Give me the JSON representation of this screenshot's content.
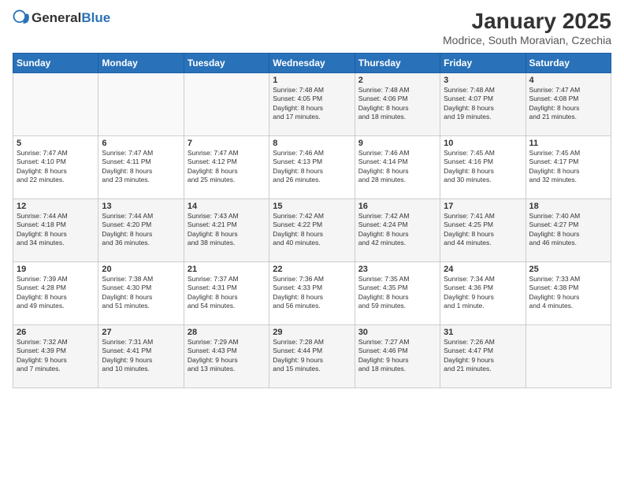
{
  "header": {
    "logo_general": "General",
    "logo_blue": "Blue",
    "title": "January 2025",
    "subtitle": "Modrice, South Moravian, Czechia"
  },
  "weekdays": [
    "Sunday",
    "Monday",
    "Tuesday",
    "Wednesday",
    "Thursday",
    "Friday",
    "Saturday"
  ],
  "weeks": [
    [
      {
        "day": "",
        "info": ""
      },
      {
        "day": "",
        "info": ""
      },
      {
        "day": "",
        "info": ""
      },
      {
        "day": "1",
        "info": "Sunrise: 7:48 AM\nSunset: 4:05 PM\nDaylight: 8 hours\nand 17 minutes."
      },
      {
        "day": "2",
        "info": "Sunrise: 7:48 AM\nSunset: 4:06 PM\nDaylight: 8 hours\nand 18 minutes."
      },
      {
        "day": "3",
        "info": "Sunrise: 7:48 AM\nSunset: 4:07 PM\nDaylight: 8 hours\nand 19 minutes."
      },
      {
        "day": "4",
        "info": "Sunrise: 7:47 AM\nSunset: 4:08 PM\nDaylight: 8 hours\nand 21 minutes."
      }
    ],
    [
      {
        "day": "5",
        "info": "Sunrise: 7:47 AM\nSunset: 4:10 PM\nDaylight: 8 hours\nand 22 minutes."
      },
      {
        "day": "6",
        "info": "Sunrise: 7:47 AM\nSunset: 4:11 PM\nDaylight: 8 hours\nand 23 minutes."
      },
      {
        "day": "7",
        "info": "Sunrise: 7:47 AM\nSunset: 4:12 PM\nDaylight: 8 hours\nand 25 minutes."
      },
      {
        "day": "8",
        "info": "Sunrise: 7:46 AM\nSunset: 4:13 PM\nDaylight: 8 hours\nand 26 minutes."
      },
      {
        "day": "9",
        "info": "Sunrise: 7:46 AM\nSunset: 4:14 PM\nDaylight: 8 hours\nand 28 minutes."
      },
      {
        "day": "10",
        "info": "Sunrise: 7:45 AM\nSunset: 4:16 PM\nDaylight: 8 hours\nand 30 minutes."
      },
      {
        "day": "11",
        "info": "Sunrise: 7:45 AM\nSunset: 4:17 PM\nDaylight: 8 hours\nand 32 minutes."
      }
    ],
    [
      {
        "day": "12",
        "info": "Sunrise: 7:44 AM\nSunset: 4:18 PM\nDaylight: 8 hours\nand 34 minutes."
      },
      {
        "day": "13",
        "info": "Sunrise: 7:44 AM\nSunset: 4:20 PM\nDaylight: 8 hours\nand 36 minutes."
      },
      {
        "day": "14",
        "info": "Sunrise: 7:43 AM\nSunset: 4:21 PM\nDaylight: 8 hours\nand 38 minutes."
      },
      {
        "day": "15",
        "info": "Sunrise: 7:42 AM\nSunset: 4:22 PM\nDaylight: 8 hours\nand 40 minutes."
      },
      {
        "day": "16",
        "info": "Sunrise: 7:42 AM\nSunset: 4:24 PM\nDaylight: 8 hours\nand 42 minutes."
      },
      {
        "day": "17",
        "info": "Sunrise: 7:41 AM\nSunset: 4:25 PM\nDaylight: 8 hours\nand 44 minutes."
      },
      {
        "day": "18",
        "info": "Sunrise: 7:40 AM\nSunset: 4:27 PM\nDaylight: 8 hours\nand 46 minutes."
      }
    ],
    [
      {
        "day": "19",
        "info": "Sunrise: 7:39 AM\nSunset: 4:28 PM\nDaylight: 8 hours\nand 49 minutes."
      },
      {
        "day": "20",
        "info": "Sunrise: 7:38 AM\nSunset: 4:30 PM\nDaylight: 8 hours\nand 51 minutes."
      },
      {
        "day": "21",
        "info": "Sunrise: 7:37 AM\nSunset: 4:31 PM\nDaylight: 8 hours\nand 54 minutes."
      },
      {
        "day": "22",
        "info": "Sunrise: 7:36 AM\nSunset: 4:33 PM\nDaylight: 8 hours\nand 56 minutes."
      },
      {
        "day": "23",
        "info": "Sunrise: 7:35 AM\nSunset: 4:35 PM\nDaylight: 8 hours\nand 59 minutes."
      },
      {
        "day": "24",
        "info": "Sunrise: 7:34 AM\nSunset: 4:36 PM\nDaylight: 9 hours\nand 1 minute."
      },
      {
        "day": "25",
        "info": "Sunrise: 7:33 AM\nSunset: 4:38 PM\nDaylight: 9 hours\nand 4 minutes."
      }
    ],
    [
      {
        "day": "26",
        "info": "Sunrise: 7:32 AM\nSunset: 4:39 PM\nDaylight: 9 hours\nand 7 minutes."
      },
      {
        "day": "27",
        "info": "Sunrise: 7:31 AM\nSunset: 4:41 PM\nDaylight: 9 hours\nand 10 minutes."
      },
      {
        "day": "28",
        "info": "Sunrise: 7:29 AM\nSunset: 4:43 PM\nDaylight: 9 hours\nand 13 minutes."
      },
      {
        "day": "29",
        "info": "Sunrise: 7:28 AM\nSunset: 4:44 PM\nDaylight: 9 hours\nand 15 minutes."
      },
      {
        "day": "30",
        "info": "Sunrise: 7:27 AM\nSunset: 4:46 PM\nDaylight: 9 hours\nand 18 minutes."
      },
      {
        "day": "31",
        "info": "Sunrise: 7:26 AM\nSunset: 4:47 PM\nDaylight: 9 hours\nand 21 minutes."
      },
      {
        "day": "",
        "info": ""
      }
    ]
  ]
}
